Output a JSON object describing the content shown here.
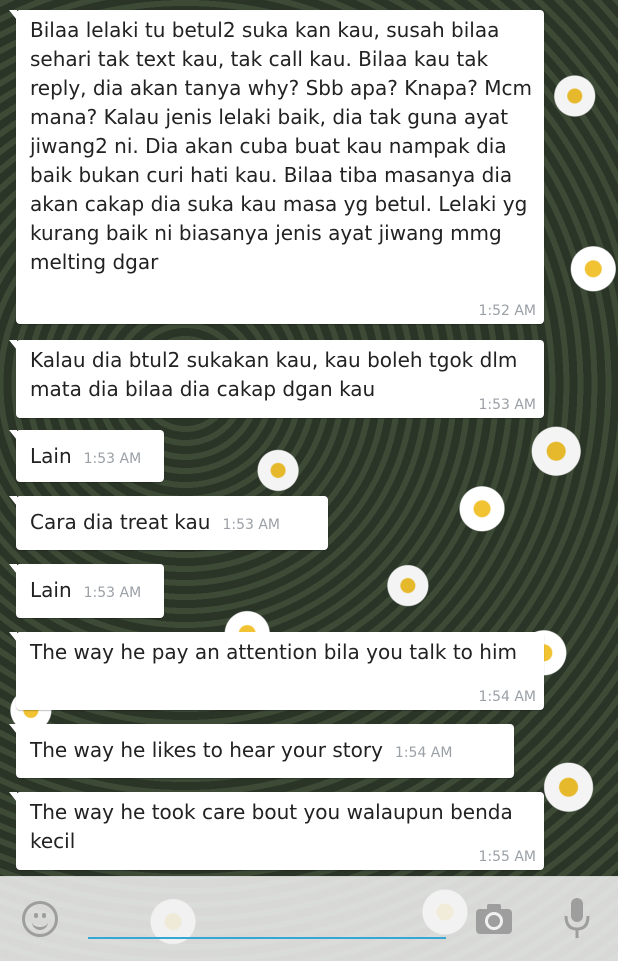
{
  "messages": [
    {
      "text": "Bilaa lelaki tu betul2 suka kan kau, susah bilaa sehari tak text kau, tak call kau. Bilaa kau tak reply, dia akan tanya why? Sbb apa? Knapa? Mcm mana? Kalau jenis lelaki baik, dia tak guna ayat jiwang2 ni. Dia akan cuba buat kau nampak dia baik bukan curi hati kau. Bilaa tiba masanya dia akan cakap dia suka kau masa yg betul. Lelaki yg kurang baik ni biasanya jenis ayat jiwang mmg melting dgar",
      "time": "1:52 AM"
    },
    {
      "text": "Kalau dia btul2 sukakan kau, kau boleh tgok dlm mata dia bilaa dia cakap dgan kau",
      "time": "1:53 AM"
    },
    {
      "text": "Lain",
      "time": "1:53 AM"
    },
    {
      "text": "Cara dia treat kau",
      "time": "1:53 AM"
    },
    {
      "text": "Lain",
      "time": "1:53 AM"
    },
    {
      "text": "The way he pay an attention bila you talk to him",
      "time": "1:54 AM"
    },
    {
      "text": "The way he likes to hear your story",
      "time": "1:54 AM"
    },
    {
      "text": "The way he took care bout you walaupun benda kecil",
      "time": "1:55 AM"
    }
  ],
  "input": {
    "placeholder": ""
  },
  "icons": {
    "emoji": "emoji-icon",
    "camera": "camera-icon",
    "mic": "mic-icon"
  },
  "colors": {
    "bubble": "#ffffff",
    "timestamp": "#9aa0a6",
    "input_underline": "#34a7d2"
  }
}
